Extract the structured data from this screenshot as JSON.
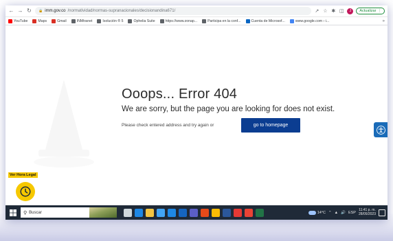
{
  "browser": {
    "url_host": "imm.gov.co",
    "url_path": "/normatividad/normas-supranacionales/decisionandina671/",
    "update_label": "Actualizar",
    "profile_initial": "J",
    "bookmarks": [
      {
        "label": "YouTube",
        "color": "#ff0000"
      },
      {
        "label": "Maps",
        "color": "#d93025"
      },
      {
        "label": "Gmail",
        "color": "#d93025"
      },
      {
        "label": "INMtranet",
        "color": "#5f6368"
      },
      {
        "label": "Isolución ® 5",
        "color": "#5f6368"
      },
      {
        "label": "Ophelia Suite",
        "color": "#5f6368"
      },
      {
        "label": "https://www.zonap...",
        "color": "#5f6368"
      },
      {
        "label": "Participa en la conf...",
        "color": "#5f6368"
      },
      {
        "label": "Cuenta de Microsof...",
        "color": "#0a66c2"
      },
      {
        "label": "www.google.com › i...",
        "color": "#4285f4"
      }
    ]
  },
  "page": {
    "error_title": "Ooops... Error 404",
    "error_subtitle": "We are sorry, but the page you are looking for does not exist.",
    "hint": "Please check entered address and try again or",
    "home_button": "go to homepage",
    "hora_label": "Ver Hora Legal",
    "accent_color": "#0b3d91",
    "hora_color": "#f6c800"
  },
  "taskbar": {
    "search_placeholder": "Buscar",
    "temperature": "14°C",
    "language": "ESP",
    "time": "11:41 p. m.",
    "date": "28/05/2023",
    "apps": [
      {
        "icon": "task-view-icon",
        "color": "#cfd8dc"
      },
      {
        "icon": "edge-icon",
        "color": "#1e88e5"
      },
      {
        "icon": "file-explorer-icon",
        "color": "#f4c542"
      },
      {
        "icon": "store-icon",
        "color": "#42a5f5"
      },
      {
        "icon": "mail-icon",
        "color": "#1e88e5"
      },
      {
        "icon": "outlook-icon",
        "color": "#1565c0"
      },
      {
        "icon": "teams-icon",
        "color": "#5b5fc7"
      },
      {
        "icon": "office-icon",
        "color": "#e64a19"
      },
      {
        "icon": "chrome-icon",
        "color": "#fbbc05"
      },
      {
        "icon": "word-icon",
        "color": "#2b579a"
      },
      {
        "icon": "app-red-icon",
        "color": "#e53935"
      },
      {
        "icon": "chrome-alt-icon",
        "color": "#ea4335"
      },
      {
        "icon": "excel-icon",
        "color": "#217346"
      }
    ]
  }
}
